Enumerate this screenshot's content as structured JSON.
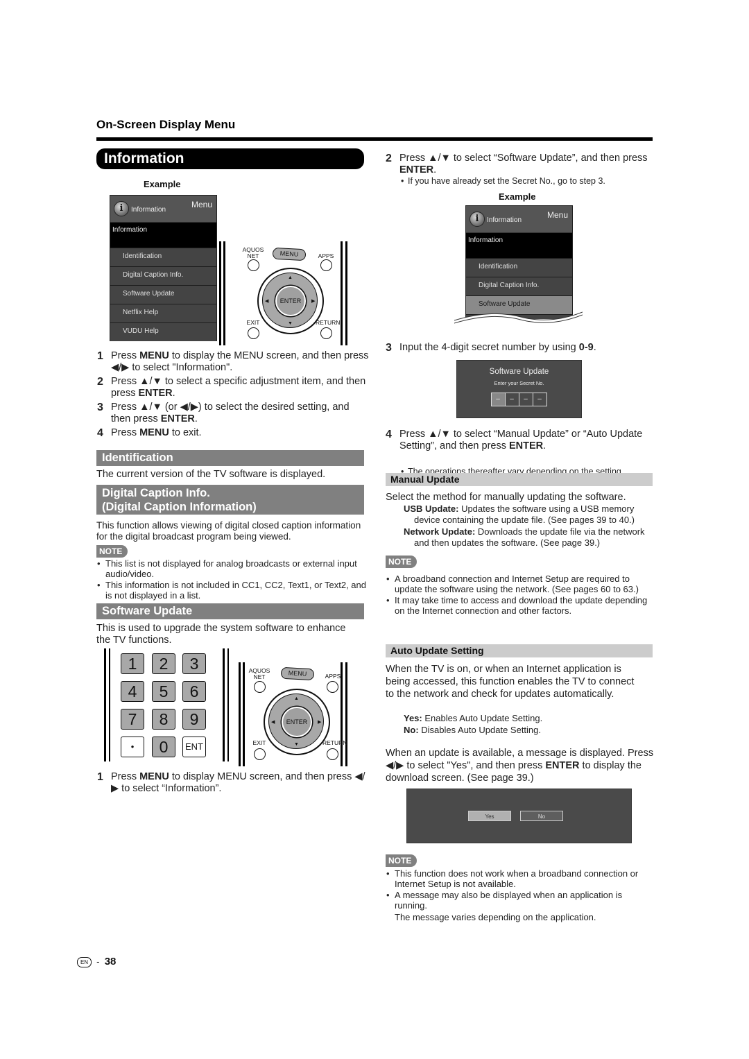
{
  "page": {
    "section_title": "On-Screen Display Menu",
    "header_pill": "Information",
    "page_label": "EN",
    "page_separator": "-",
    "page_number": "38"
  },
  "left": {
    "example_label": "Example",
    "tv_menu": {
      "icon": "info-icon",
      "icon_glyph": "i",
      "header_label": "Information",
      "menu_label": "Menu",
      "selected_label": "Information",
      "items": [
        "Identification",
        "Digital Caption Info.",
        "Software Update",
        "Netflix Help",
        "VUDU Help"
      ]
    },
    "remote": {
      "aquos_net_line1": "AQUOS",
      "aquos_net_line2": "NET",
      "menu": "MENU",
      "apps": "APPS",
      "enter": "ENTER",
      "exit": "EXIT",
      "return": "RETURN",
      "up": "▲",
      "down": "▼",
      "left": "◀",
      "right": "▶"
    },
    "steps": [
      {
        "num": "1",
        "pre": "Press ",
        "bold1": "MENU",
        "mid": " to display the MENU screen, and then press ◀/▶ to select \"Information\".",
        "bold2": "",
        "post": ""
      },
      {
        "num": "2",
        "pre": "Press ▲/▼ to select a specific adjustment item, and then press ",
        "bold1": "ENTER",
        "mid": ".",
        "bold2": "",
        "post": ""
      },
      {
        "num": "3",
        "pre": "Press ▲/▼ (or ◀/▶) to select the desired setting, and then press ",
        "bold1": "ENTER",
        "mid": ".",
        "bold2": "",
        "post": ""
      },
      {
        "num": "4",
        "pre": "Press ",
        "bold1": "MENU",
        "mid": " to exit.",
        "bold2": "",
        "post": ""
      }
    ],
    "identification": {
      "title": "Identification",
      "text": "The current version of the TV software is displayed."
    },
    "digital_caption": {
      "title_line1": "Digital Caption Info.",
      "title_line2": "(Digital Caption Information)",
      "text": "This function allows viewing of digital closed caption information for the digital broadcast program being viewed.",
      "note_label": "NOTE",
      "notes": [
        "This list is not displayed for analog broadcasts or external input audio/video.",
        "This information is not included in CC1, CC2, Text1, or Text2, and is not displayed in a list."
      ]
    },
    "software_update": {
      "title": "Software Update",
      "text": "This is used to upgrade the system software to enhance the TV functions.",
      "numpad": [
        "1",
        "2",
        "3",
        "4",
        "5",
        "6",
        "7",
        "8",
        "9",
        "•",
        "0",
        "ENT"
      ],
      "step1": {
        "num": "1",
        "pre": "Press ",
        "bold": "MENU",
        "post": " to display MENU screen, and then press ◀/▶ to select “Information”."
      }
    }
  },
  "right": {
    "step2": {
      "num": "2",
      "pre": "Press ▲/▼ to select “Software Update”, and then press ",
      "bold": "ENTER",
      "post": "."
    },
    "step2_sub": "If you have already set the Secret No., go to step 3.",
    "example_label": "Example",
    "tv_menu": {
      "icon_glyph": "i",
      "header_label": "Information",
      "menu_label": "Menu",
      "selected_label": "Information",
      "items": [
        "Identification",
        "Digital Caption Info.",
        "Software Update"
      ],
      "highlighted_index": 2
    },
    "step3": {
      "num": "3",
      "pre": "Input the 4-digit secret number by using ",
      "bold": "0",
      "dash": "-",
      "bold2": "9",
      "post": "."
    },
    "secret_dialog": {
      "title": "Software Update",
      "prompt": "Enter your Secret No.",
      "digits": [
        "–",
        "–",
        "–",
        "–"
      ]
    },
    "step4": {
      "num": "4",
      "pre": "Press ▲/▼ to select “Manual Update” or “Auto Update Setting”, and then press ",
      "bold": "ENTER",
      "post": "."
    },
    "step4_sub": "The operations thereafter vary depending on the setting.",
    "manual_update": {
      "title": "Manual Update",
      "text": "Select the method for manually updating the software.",
      "options": [
        {
          "label": "USB Update:",
          "desc": " Updates the software using a USB memory device containing the update file. (See pages 39 to 40.)"
        },
        {
          "label": "Network Update:",
          "desc": " Downloads the update file via the network and then updates the software. (See page 39.)"
        }
      ],
      "note_label": "NOTE",
      "notes": [
        "A broadband connection and Internet Setup are required to update the software using the network. (See pages 60 to 63.)",
        "It may take time to access and download the update depending on the Internet connection and other factors."
      ]
    },
    "auto_update": {
      "title": "Auto Update Setting",
      "text": "When the TV is on, or when an Internet application is being accessed, this function enables the TV to connect to the network and check for updates automatically.",
      "options": [
        {
          "label": "Yes:",
          "desc": " Enables Auto Update Setting."
        },
        {
          "label": "No:",
          "desc": " Disables Auto Update Setting."
        }
      ],
      "message_pre": "When an update is available, a message is displayed. Press ◀/▶ to select \"Yes\", and then press ",
      "message_bold": "ENTER",
      "message_post": " to display the download screen. (See page 39.)",
      "dialog": {
        "yes": "Yes",
        "no": "No"
      },
      "note_label": "NOTE",
      "notes": [
        "This function does not work when a broadband connection or Internet Setup is not available.",
        "A message may also be displayed when an application is running."
      ],
      "notes_trailing": "The message varies depending on the application."
    }
  }
}
